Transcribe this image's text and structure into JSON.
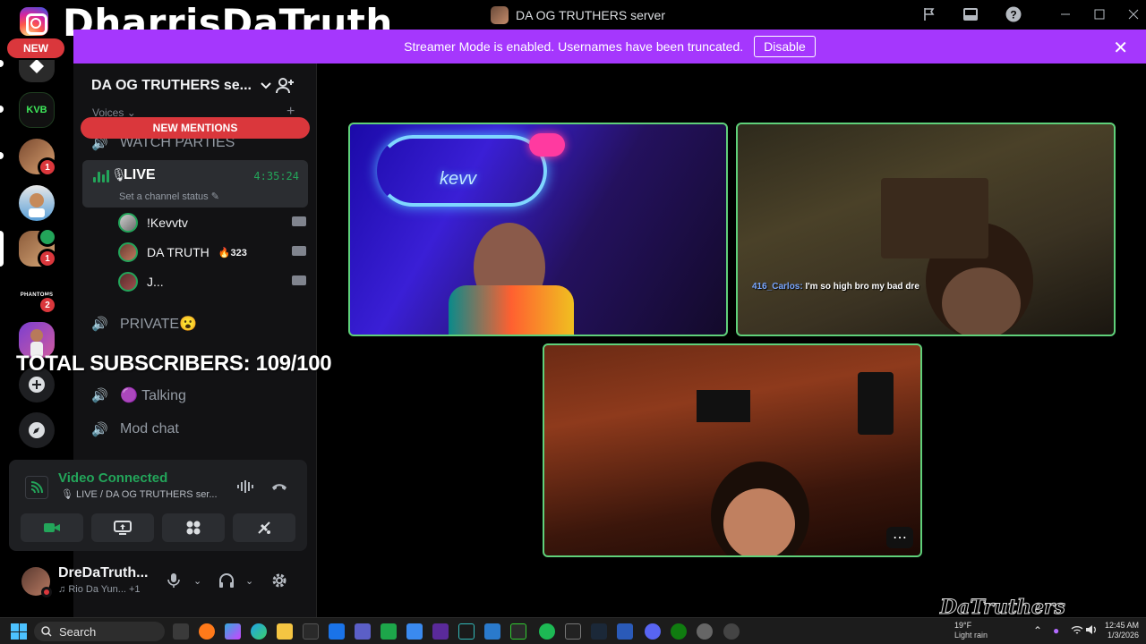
{
  "overlay": {
    "brand_name": "DharrisDaTruth",
    "new_badge": "NEW",
    "subscribers_text": "TOTAL SUBSCRIBERS: 109/100",
    "watermark": "DaTruthers"
  },
  "window": {
    "title": "DA OG TRUTHERS server"
  },
  "banner": {
    "message": "Streamer Mode is enabled. Usernames have been truncated.",
    "disable_label": "Disable",
    "color": "#a537fd"
  },
  "server_rail": {
    "items": [
      {
        "name": "server-1",
        "badge": ""
      },
      {
        "name": "kvb",
        "label": "KVB",
        "badge": ""
      },
      {
        "name": "server-3",
        "badge": "1"
      },
      {
        "name": "server-4",
        "badge": ""
      },
      {
        "name": "server-5",
        "badge": "1"
      },
      {
        "name": "phantoms",
        "label": "PHANTOMS",
        "badge": "2"
      },
      {
        "name": "server-7",
        "badge": ""
      }
    ],
    "add_server_icon": "plus-icon",
    "discover_icon": "compass-icon"
  },
  "sidebar": {
    "server_name": "DA OG TRUTHERS se...",
    "category": "Voices",
    "new_mentions": "NEW MENTIONS",
    "channels_above": [
      {
        "name": "WATCH PARTIES"
      }
    ],
    "live_channel": {
      "name": "LIVE",
      "timer": "4:35:24",
      "status_placeholder": "Set a channel status"
    },
    "members": [
      {
        "name": "!Kevvtv",
        "extra": ""
      },
      {
        "name": "DA TRUTH",
        "extra": "323"
      },
      {
        "name": "J...",
        "extra": ""
      }
    ],
    "channels_below": [
      {
        "name": "PRIVATE😮"
      },
      {
        "name": "🟣 Talking"
      },
      {
        "name": "Mod chat"
      }
    ]
  },
  "voice_panel": {
    "title": "Video Connected",
    "subtitle": "LIVE / DA OG TRUTHERS ser..."
  },
  "user_panel": {
    "username": "DreDaTruth...",
    "status": "Rio Da Yun... +1"
  },
  "video": {
    "tile2_chat_user": "416_Carlos:",
    "tile2_chat_text": "I'm so high bro my bad dre",
    "tile1_neon": "kevv"
  },
  "taskbar": {
    "search_label": "Search",
    "weather_temp": "19°F",
    "weather_cond": "Light rain",
    "time": "12:45 AM",
    "date": "1/3/2026"
  }
}
